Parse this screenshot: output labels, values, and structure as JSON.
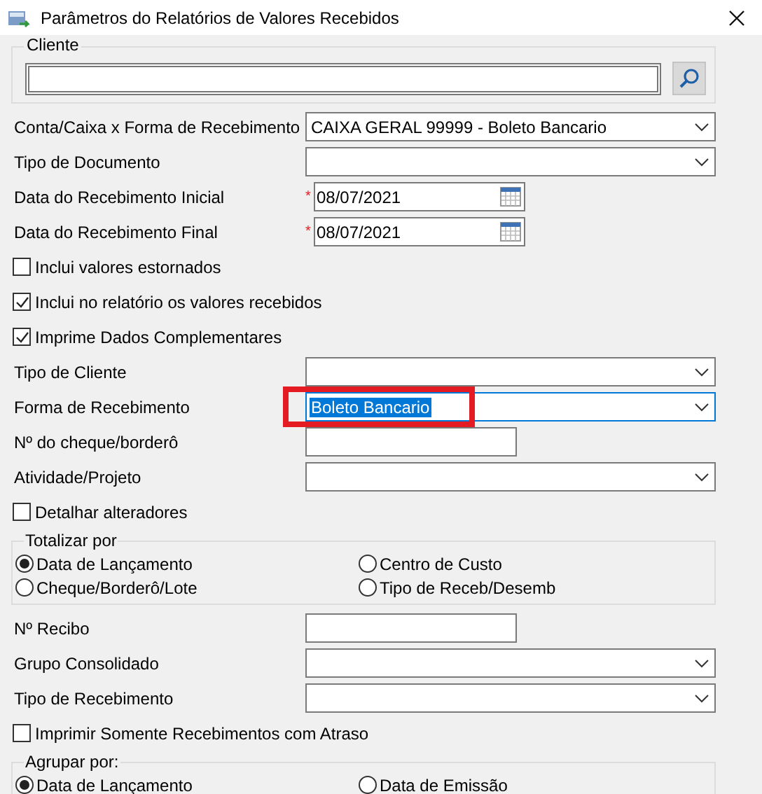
{
  "window": {
    "title": "Parâmetros do Relatórios de Valores Recebidos"
  },
  "cliente_group": {
    "legend": "Cliente"
  },
  "fields": [
    {
      "kind": "dropdown",
      "label": "Conta/Caixa x Forma de Recebimento",
      "value": "CAIXA GERAL 99999 - Boleto Bancario"
    },
    {
      "kind": "dropdown",
      "label": "Tipo de Documento"
    },
    {
      "kind": "date",
      "label": "Data do Recebimento Inicial",
      "required_mark": "*",
      "value": "08/07/2021"
    },
    {
      "kind": "date",
      "label": "Data do Recebimento Final",
      "required_mark": "*",
      "value": "08/07/2021"
    },
    {
      "kind": "checkbox",
      "label": "Inclui valores estornados",
      "checked": false
    },
    {
      "kind": "checkbox",
      "label": "Inclui no relatório os valores recebidos",
      "checked": true
    },
    {
      "kind": "checkbox",
      "label": "Imprime Dados Complementares",
      "checked": true
    },
    {
      "kind": "dropdown",
      "label": "Tipo de Cliente"
    },
    {
      "kind": "dropdown",
      "label": "Forma de Recebimento",
      "value": "Boleto Bancario",
      "focused": true,
      "annotated": true
    },
    {
      "kind": "text",
      "label": "Nº do cheque/borderô"
    },
    {
      "kind": "dropdown",
      "label": "Atividade/Projeto"
    },
    {
      "kind": "checkbox",
      "label": "Detalhar alteradores",
      "checked": false
    },
    {
      "kind": "radio_group",
      "legend": "Totalizar por",
      "options": [
        {
          "label": "Data de Lançamento",
          "selected": true
        },
        {
          "label": "Centro de Custo",
          "selected": false
        },
        {
          "label": "Cheque/Borderô/Lote",
          "selected": false
        },
        {
          "label": "Tipo de Receb/Desemb",
          "selected": false
        }
      ]
    },
    {
      "kind": "text",
      "label": "Nº Recibo"
    },
    {
      "kind": "dropdown",
      "label": "Grupo Consolidado"
    },
    {
      "kind": "dropdown",
      "label": "Tipo de Recebimento"
    },
    {
      "kind": "checkbox",
      "label": "Imprimir Somente Recebimentos com Atraso",
      "checked": false
    },
    {
      "kind": "radio_group",
      "legend": "Agrupar por:",
      "options": [
        {
          "label": "Data de Lançamento",
          "selected": true
        },
        {
          "label": "Data de Emissão",
          "selected": false
        }
      ]
    }
  ]
}
